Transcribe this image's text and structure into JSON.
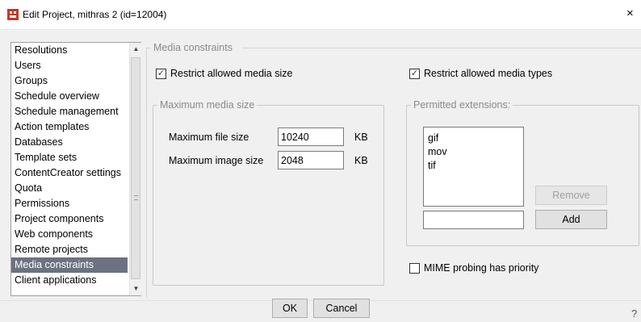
{
  "window": {
    "title": "Edit Project, mithras 2 (id=12004)",
    "close_glyph": "×",
    "help_glyph": "?"
  },
  "sidebar": {
    "items": [
      {
        "label": "Resolutions",
        "selected": false
      },
      {
        "label": "Users",
        "selected": false
      },
      {
        "label": "Groups",
        "selected": false
      },
      {
        "label": "Schedule overview",
        "selected": false
      },
      {
        "label": "Schedule management",
        "selected": false
      },
      {
        "label": "Action templates",
        "selected": false
      },
      {
        "label": "Databases",
        "selected": false
      },
      {
        "label": "Template sets",
        "selected": false
      },
      {
        "label": "ContentCreator settings",
        "selected": false
      },
      {
        "label": "Quota",
        "selected": false
      },
      {
        "label": "Permissions",
        "selected": false
      },
      {
        "label": "Project components",
        "selected": false
      },
      {
        "label": "Web components",
        "selected": false
      },
      {
        "label": "Remote projects",
        "selected": false
      },
      {
        "label": "Media constraints",
        "selected": true
      },
      {
        "label": "Client applications",
        "selected": false
      }
    ],
    "scroll_up_glyph": "▲",
    "scroll_down_glyph": "▼"
  },
  "media_constraints": {
    "header": "Media constraints",
    "restrict_size": {
      "label": "Restrict allowed media size",
      "checked": true
    },
    "restrict_types": {
      "label": "Restrict allowed media types",
      "checked": true
    },
    "max_size_group": {
      "title": "Maximum media size",
      "max_file_size_label": "Maximum file size",
      "max_file_size_value": "10240",
      "max_file_size_unit": "KB",
      "max_image_size_label": "Maximum image size",
      "max_image_size_value": "2048",
      "max_image_size_unit": "KB"
    },
    "extensions_group": {
      "title": "Permitted extensions:",
      "items": [
        "gif",
        "mov",
        "tif"
      ],
      "remove_label": "Remove",
      "add_label": "Add",
      "new_extension_value": ""
    },
    "mime_probing": {
      "label": "MIME probing has priority",
      "checked": false
    }
  },
  "footer": {
    "ok_label": "OK",
    "cancel_label": "Cancel"
  },
  "colors": {
    "selected_item_bg": "#6c7282",
    "app_icon": "#c0392b"
  },
  "icons": {
    "app": "app-logo-icon",
    "close": "close-icon",
    "check": "check-icon",
    "help": "help-icon"
  }
}
